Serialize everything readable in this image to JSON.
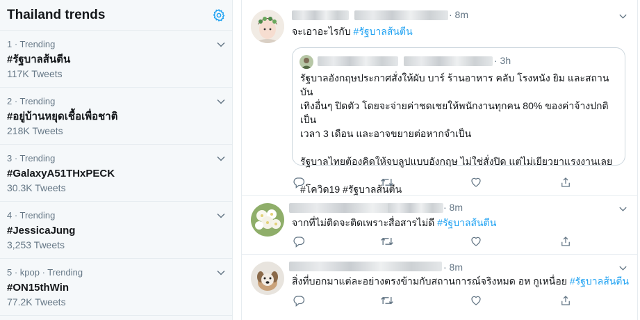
{
  "trends": {
    "title": "Thailand trends",
    "items": [
      {
        "meta": "1 · Trending",
        "name": "#รัฐบาลส้นตีน",
        "count": "117K Tweets"
      },
      {
        "meta": "2 · Trending",
        "name": "#อยู่บ้านหยุดเชื้อเพื่อชาติ",
        "count": "218K Tweets"
      },
      {
        "meta": "3 · Trending",
        "name": "#GalaxyA51THxPECK",
        "count": "30.3K Tweets"
      },
      {
        "meta": "4 · Trending",
        "name": "#JessicaJung",
        "count": "3,253 Tweets"
      },
      {
        "meta": "5 · kpop · Trending",
        "name": "#ON15thWin",
        "count": "77.2K Tweets"
      }
    ]
  },
  "tweets": [
    {
      "time": "· 8m",
      "text": "จะเอาอะไรกับ",
      "hashtag": "#รัฐบาลส้นตีน",
      "quote": {
        "time": "· 3h",
        "lines": [
          "รัฐบาลอังกฤษประกาศสั่งให้ผับ บาร์ ร้านอาหาร คลับ โรงหนัง ยิม และสถานบัน",
          "เทิงอื่นๆ ปิดตัว โดยจะจ่ายค่าชดเชยให้พนักงานทุกคน 80% ของค่าจ้างปกติเป็น",
          "เวลา 3 เดือน และอาจขยายต่อหากจำเป็น",
          "",
          "รัฐบาลไทยต้องคิดให้จบลูปแบบอังกฤษ ไม่ใช่สั่งปิด แต่ไม่เยียวยาแรงงานเลย",
          "",
          "#โควิด19 #รัฐบาลส้นตีน"
        ]
      }
    },
    {
      "time": "· 8m",
      "text": "จากที่ไม่ติดจะติดเพราะสื่อสารไม่ดี",
      "hashtag": "#รัฐบาลส้นตีน"
    },
    {
      "time": "· 8m",
      "text": "สิ่งที่บอกมาแต่ละอย่างตรงข้ามกับสถานการณ์จริงหมด อห กูเหนื่อย",
      "hashtag": "#รัฐบาลส้นตีน"
    }
  ],
  "icons": {
    "settings": "gear-icon",
    "chevron": "chevron-down-icon",
    "reply": "reply-icon",
    "retweet": "retweet-icon",
    "like": "heart-icon",
    "share": "share-icon"
  },
  "colors": {
    "accent": "#1da1f2",
    "secondary_text": "#657786",
    "panel_bg": "#f5f8fa"
  }
}
